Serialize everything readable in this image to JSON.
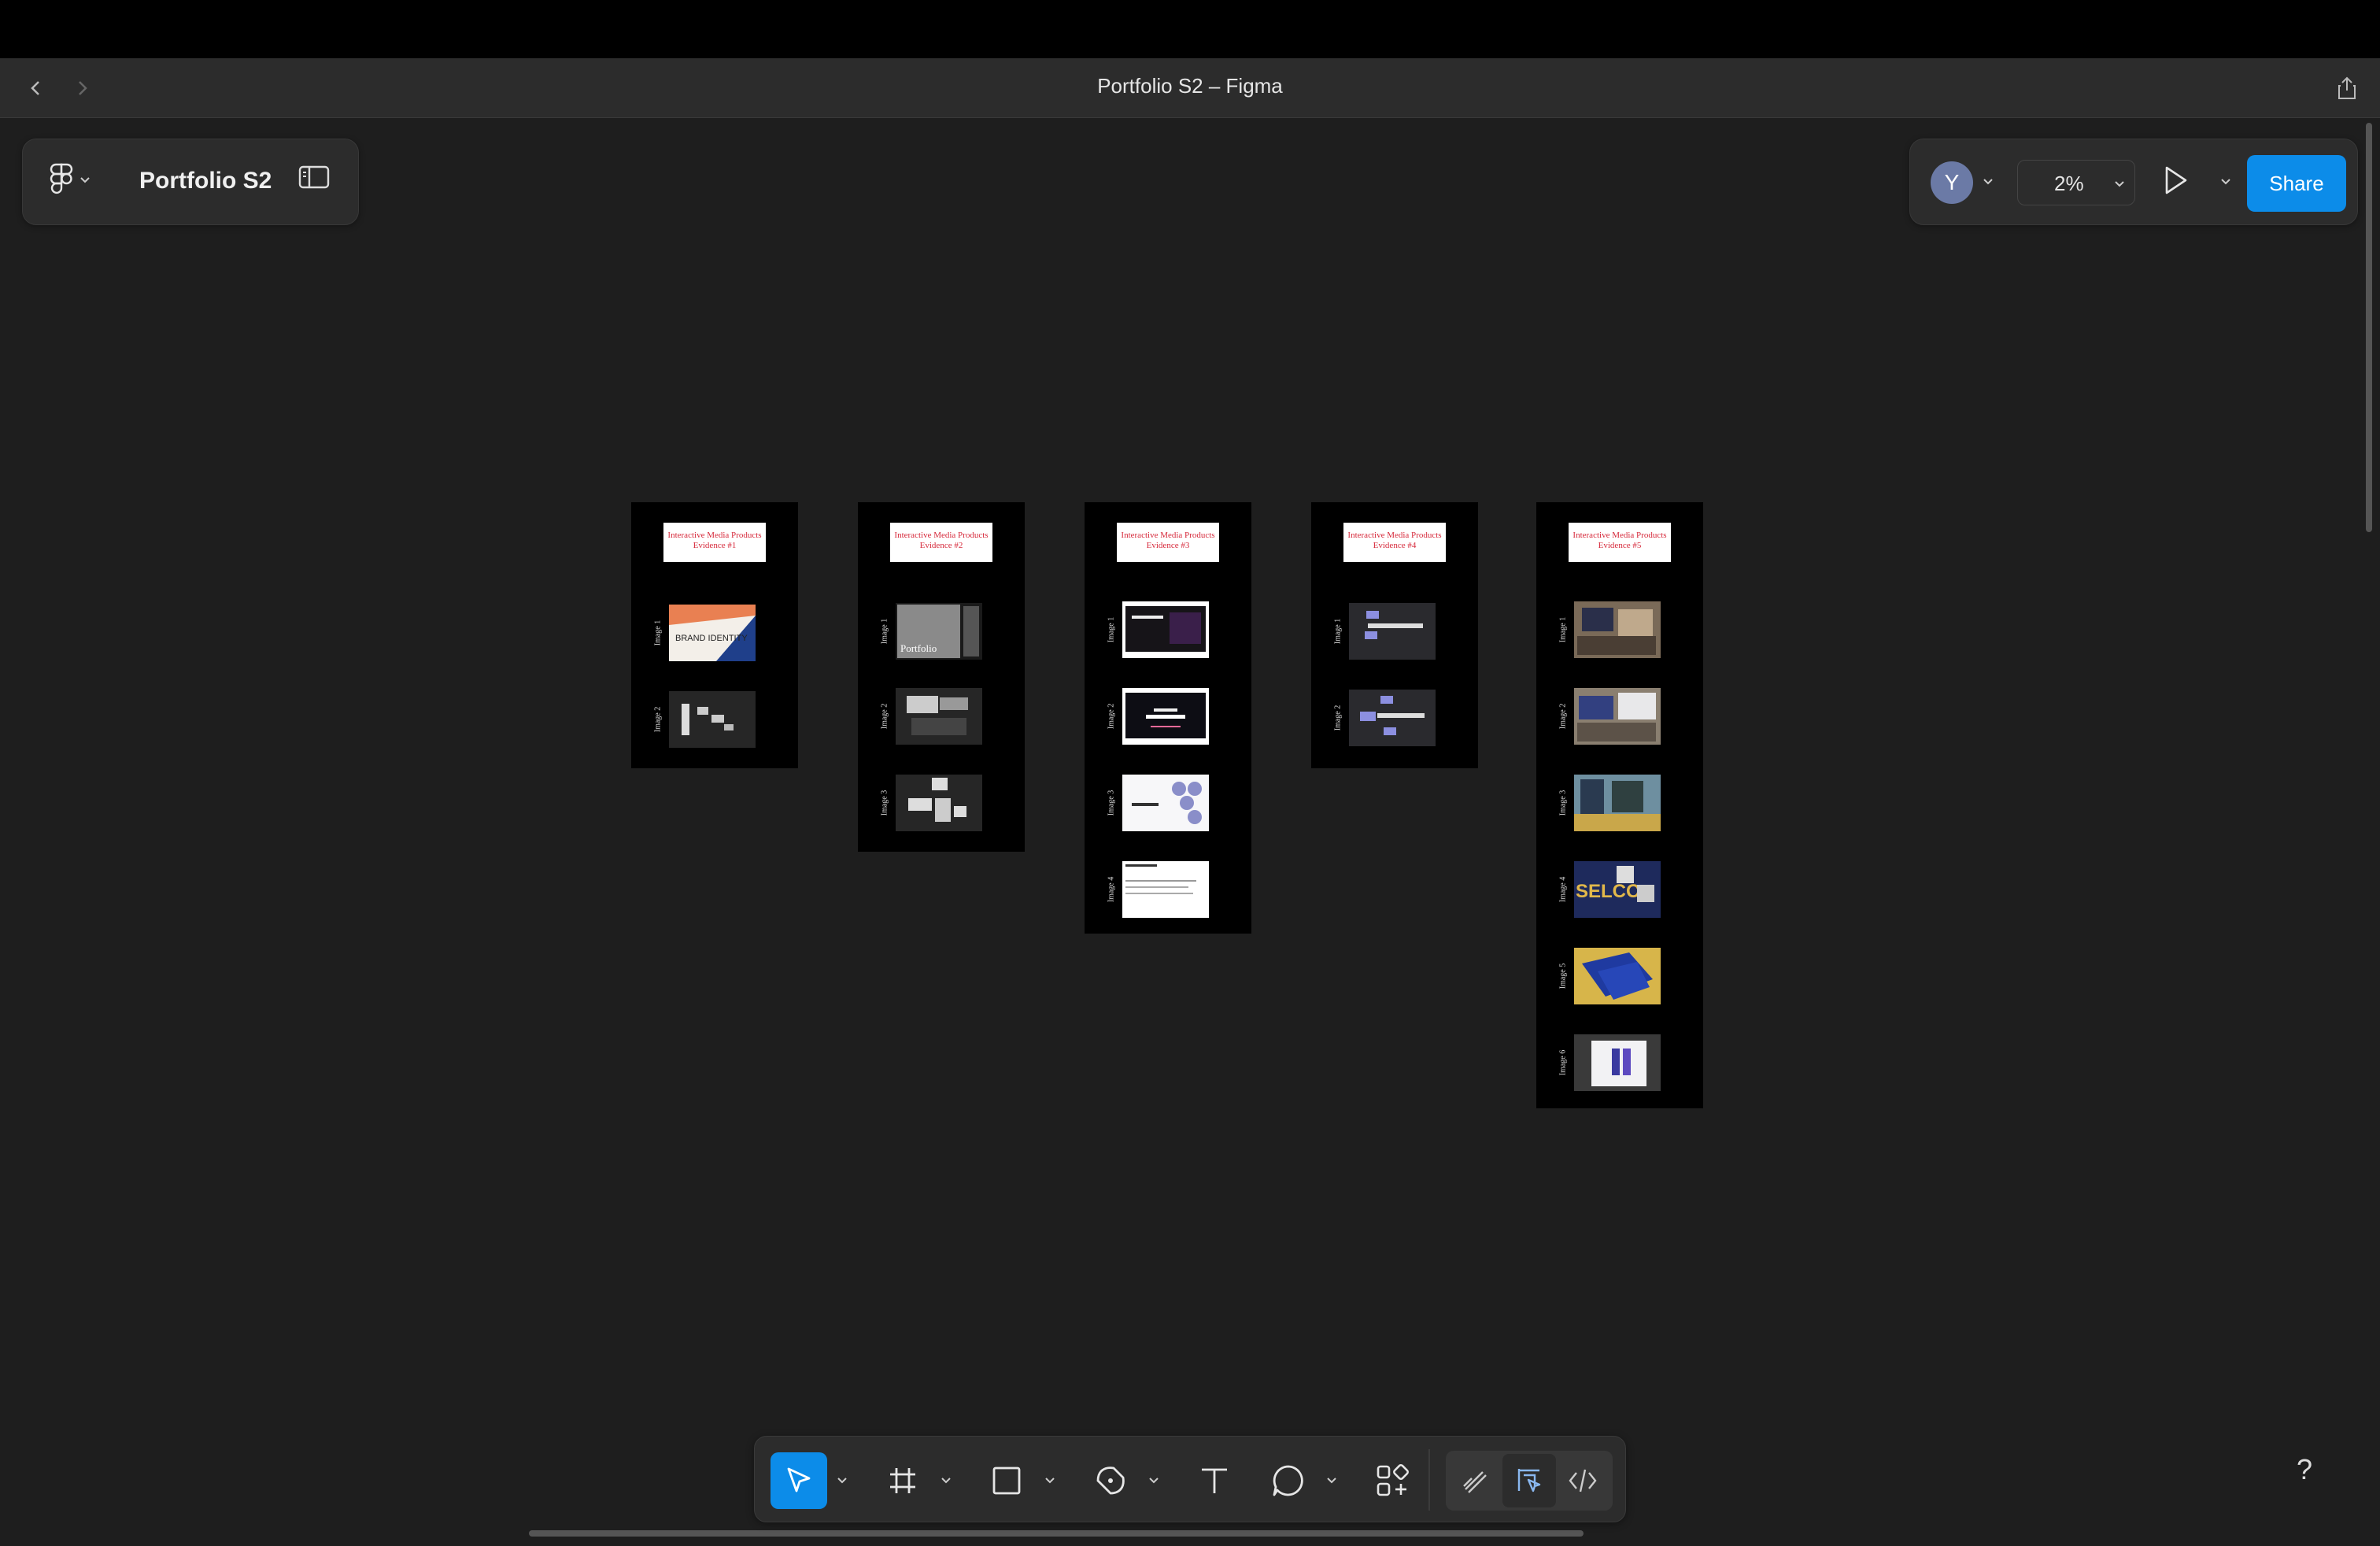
{
  "window": {
    "title": "Portfolio S2 – Figma"
  },
  "file": {
    "name": "Portfolio S2"
  },
  "user": {
    "avatar_initial": "Y"
  },
  "zoom": {
    "value": "2%"
  },
  "share": {
    "label": "Share"
  },
  "help": {
    "label": "?"
  },
  "canvas": {
    "frames": [
      {
        "header": "Interactive Media Products\nEvidence #1",
        "images": [
          "Image 1",
          "Image 2"
        ]
      },
      {
        "header": "Interactive Media Products\nEvidence #2",
        "images": [
          "Image 1",
          "Image 2",
          "Image 3"
        ]
      },
      {
        "header": "Interactive Media Products\nEvidence #3",
        "images": [
          "Image 1",
          "Image 2",
          "Image 3",
          "Image 4"
        ]
      },
      {
        "header": "Interactive Media Products\nEvidence #4",
        "images": [
          "Image 1",
          "Image 2"
        ]
      },
      {
        "header": "Interactive Media Products\nEvidence #5",
        "images": [
          "Image 1",
          "Image 2",
          "Image 3",
          "Image 4",
          "Image 5",
          "Image 6"
        ]
      }
    ],
    "thumb_texts": {
      "brand_identity": "BRAND IDENTITY",
      "portfolio": "Portfolio",
      "selco": "SELCO"
    }
  },
  "toolbar": {
    "tools": [
      "move",
      "frame",
      "rectangle",
      "pen",
      "text",
      "comment",
      "actions"
    ],
    "active_tool": "move",
    "modes": [
      "draw",
      "design",
      "dev"
    ],
    "active_mode": "design"
  },
  "colors": {
    "accent": "#0c8ce9",
    "canvas": "#1e1e1e",
    "panel": "#2c2c2c",
    "header_text": "#d6283a"
  }
}
